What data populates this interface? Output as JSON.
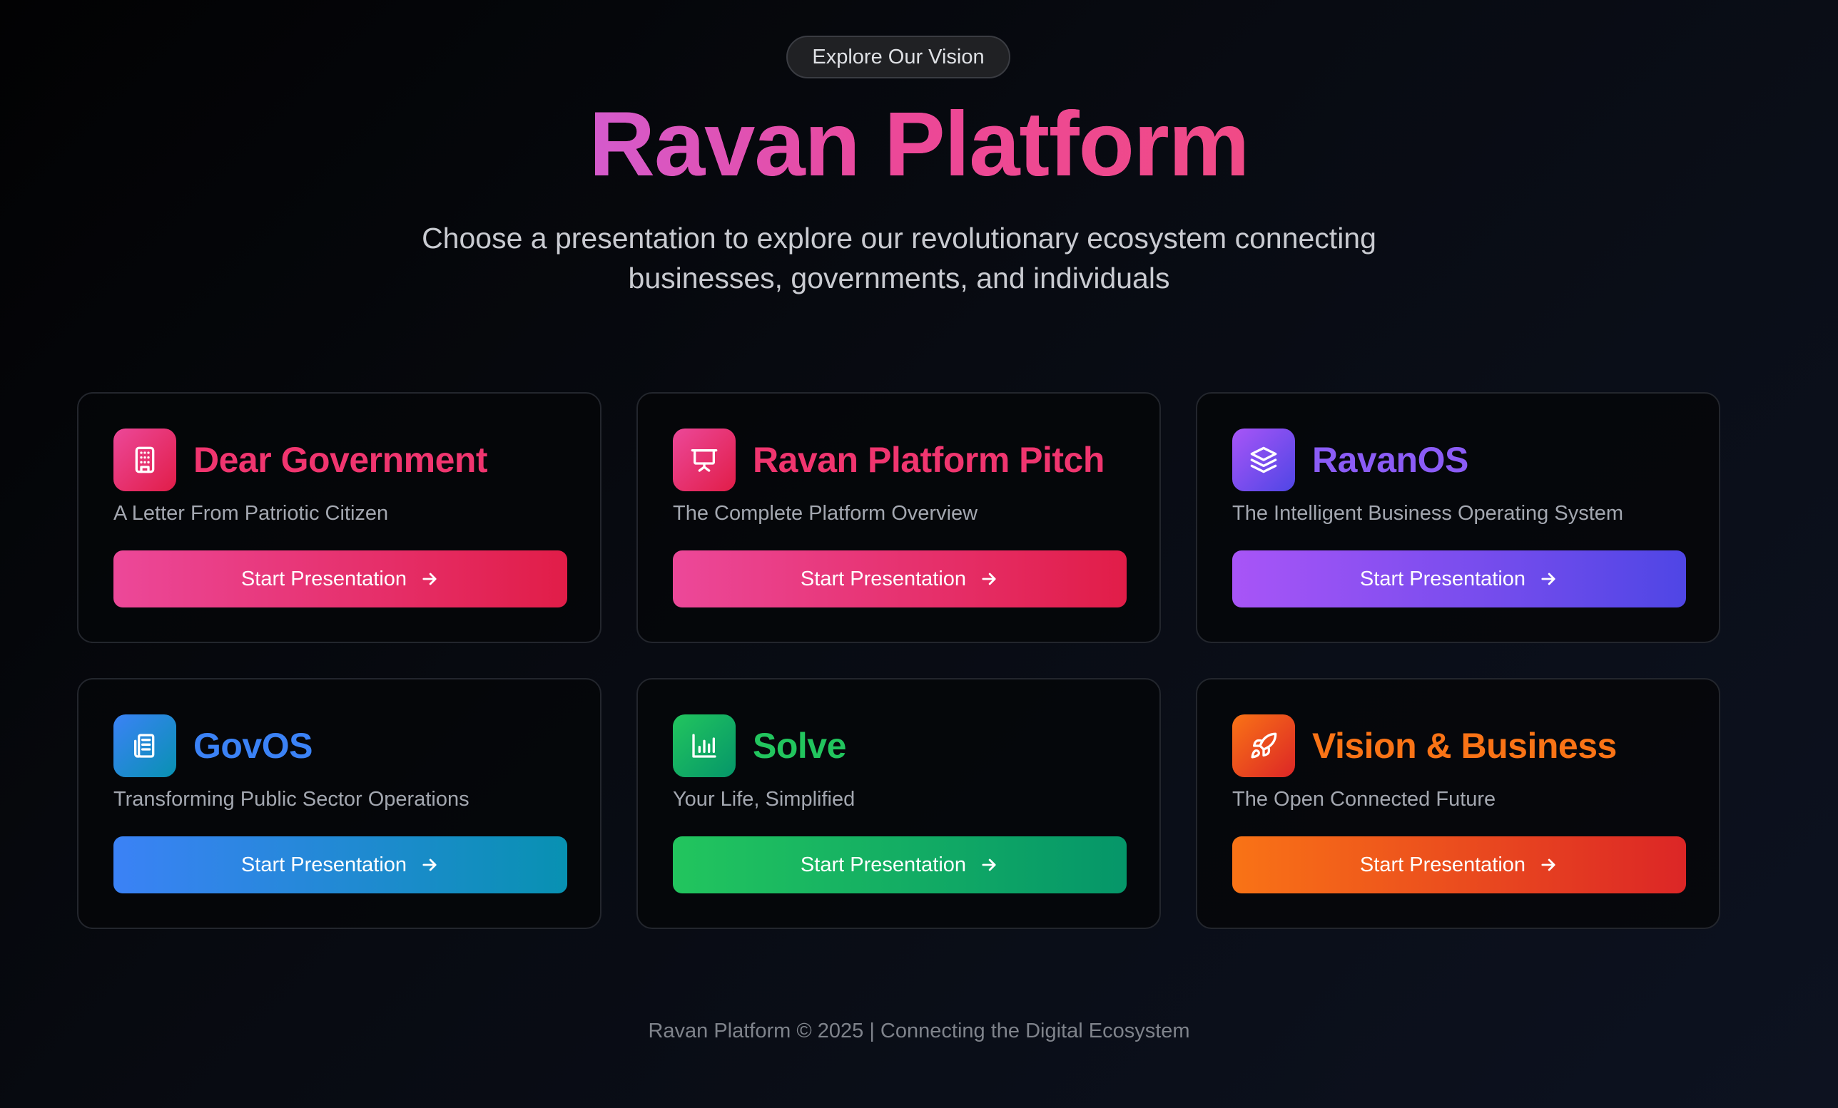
{
  "header": {
    "pill_label": "Explore Our Vision",
    "title": "Ravan Platform",
    "subtitle_line1": "Choose a presentation to explore our revolutionary ecosystem connecting",
    "subtitle_line2": "businesses, governments, and individuals"
  },
  "cards": [
    {
      "title": "Dear Government",
      "subtitle": "A Letter From Patriotic Citizen",
      "button_label": "Start Presentation",
      "icon": "building-icon",
      "title_color": "#f0356f",
      "gradient": [
        "#ec4899",
        "#e11d48"
      ]
    },
    {
      "title": "Ravan Platform Pitch",
      "subtitle": "The Complete Platform Overview",
      "button_label": "Start Presentation",
      "icon": "presentation-icon",
      "title_color": "#f0356f",
      "gradient": [
        "#ec4899",
        "#e11d48"
      ]
    },
    {
      "title": "RavanOS",
      "subtitle": "The Intelligent Business Operating System",
      "button_label": "Start Presentation",
      "icon": "layers-icon",
      "title_color": "#8b5cf6",
      "gradient": [
        "#a855f7",
        "#4f46e5"
      ]
    },
    {
      "title": "GovOS",
      "subtitle": "Transforming Public Sector Operations",
      "button_label": "Start Presentation",
      "icon": "document-icon",
      "title_color": "#3b82f6",
      "gradient": [
        "#3b82f6",
        "#0891b2"
      ]
    },
    {
      "title": "Solve",
      "subtitle": "Your Life, Simplified",
      "button_label": "Start Presentation",
      "icon": "bar-chart-icon",
      "title_color": "#22c55e",
      "gradient": [
        "#22c55e",
        "#059669"
      ]
    },
    {
      "title": "Vision & Business",
      "subtitle": "The Open Connected Future",
      "button_label": "Start Presentation",
      "icon": "rocket-icon",
      "title_color": "#f97316",
      "gradient": [
        "#f97316",
        "#dc2626"
      ]
    }
  ],
  "footer": {
    "text": "Ravan Platform © 2025 | Connecting the Digital Ecosystem"
  }
}
